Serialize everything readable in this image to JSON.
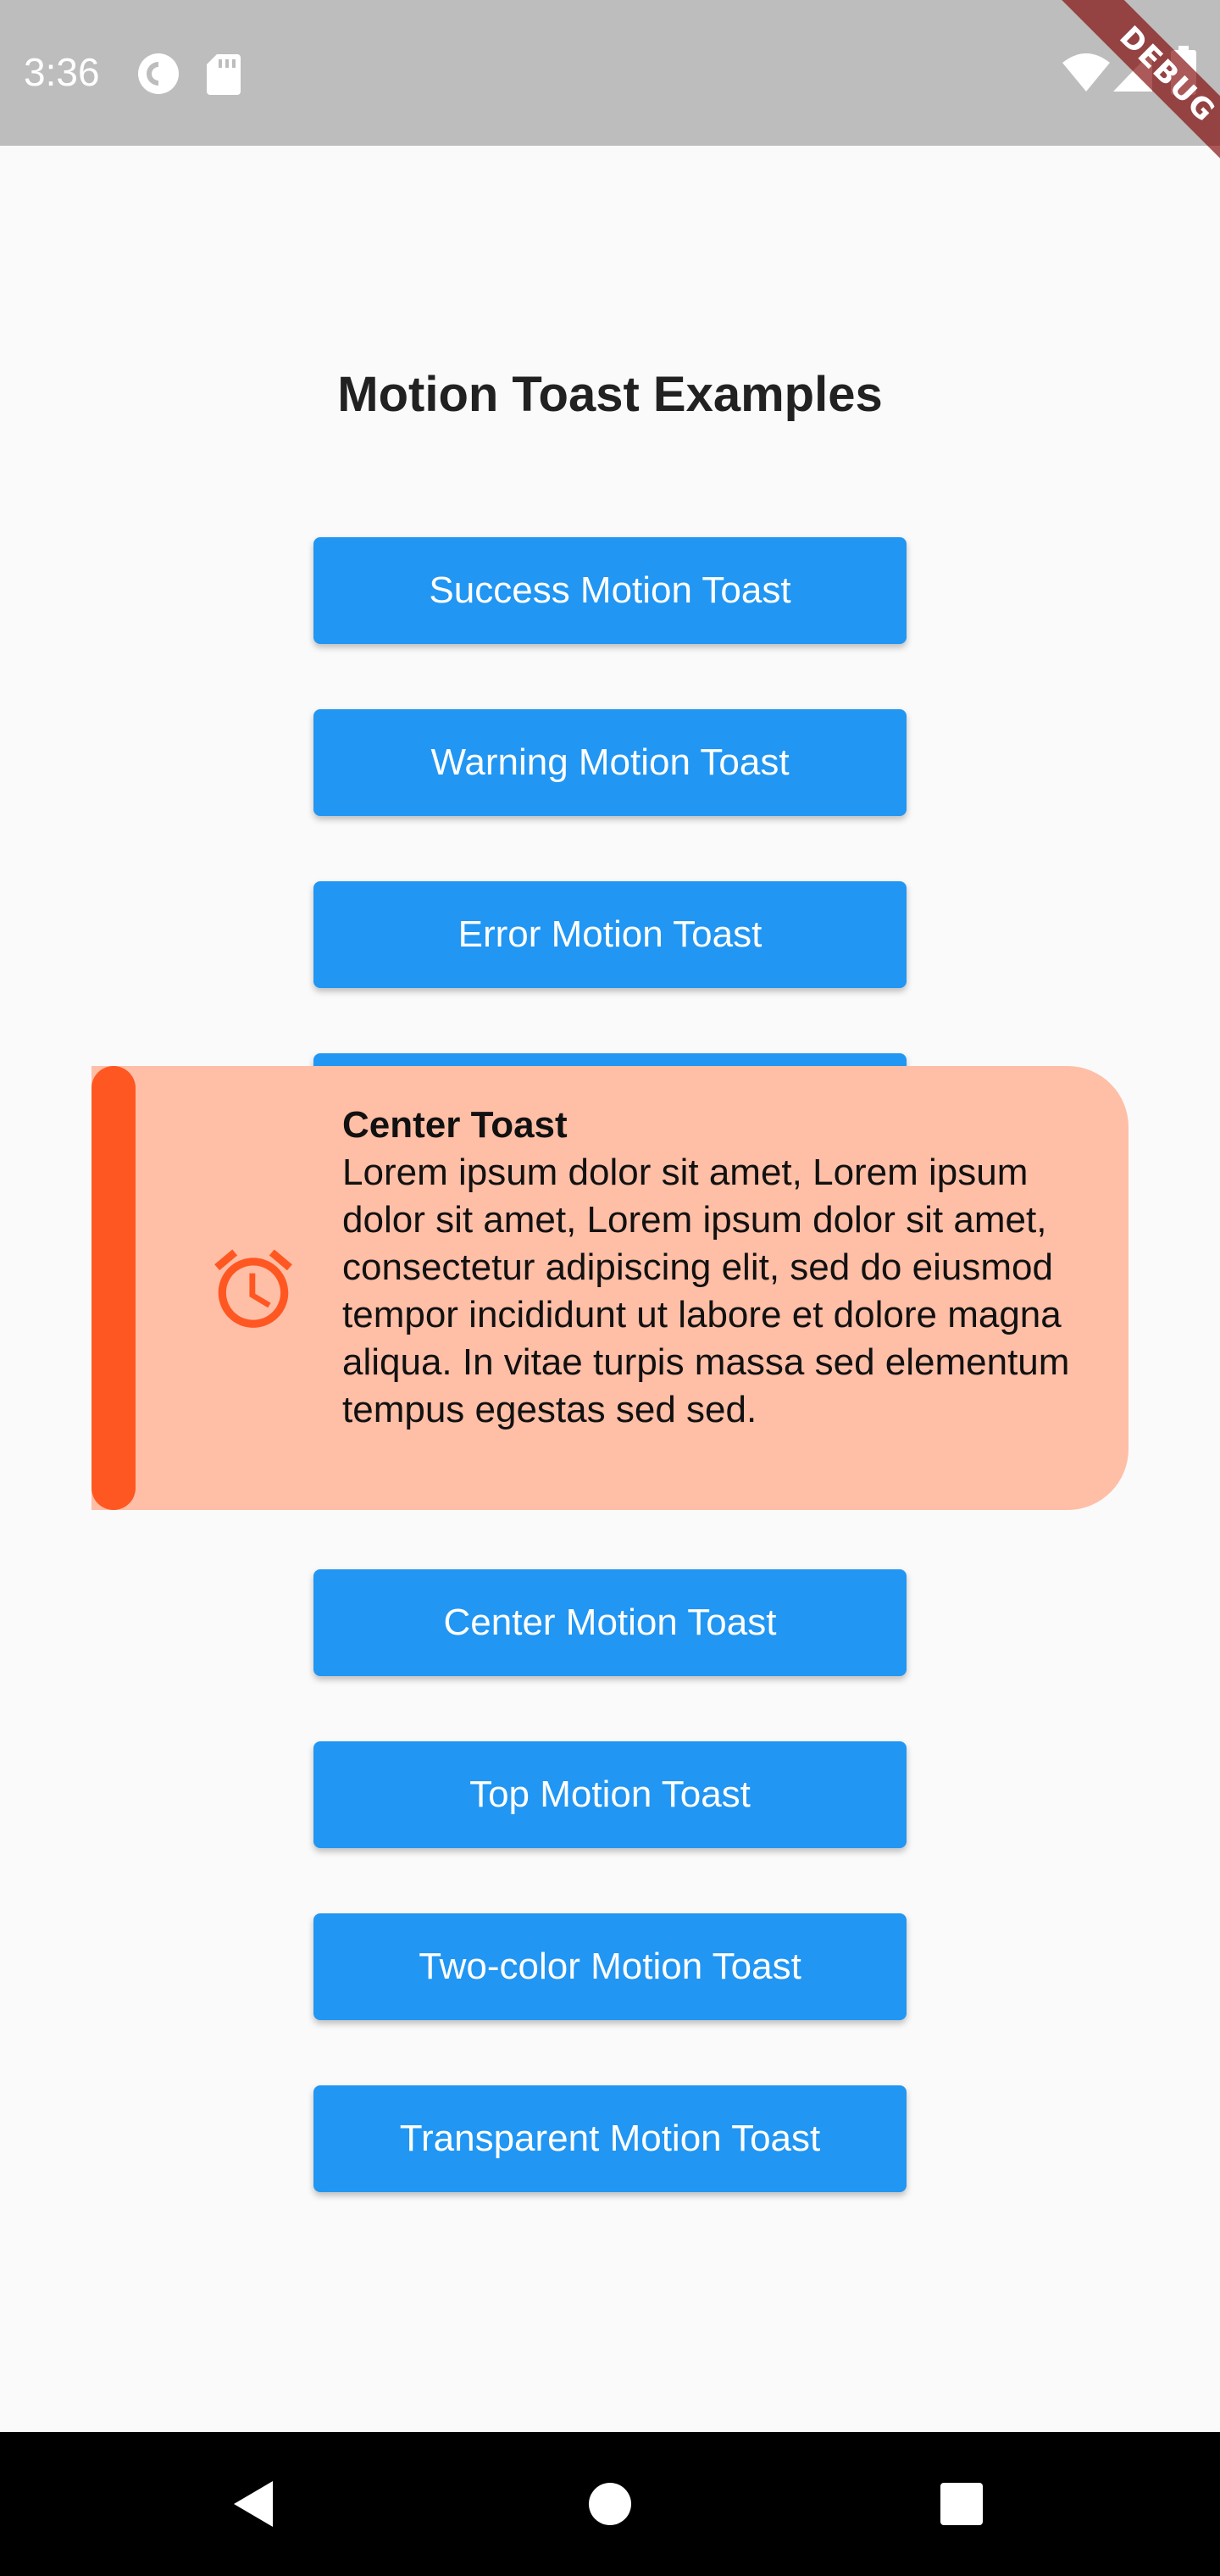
{
  "status_bar": {
    "time": "3:36",
    "debug_label": "DEBUG",
    "icons": [
      "pocket-casts-icon",
      "sd-card-icon",
      "wifi-icon",
      "cellular-signal-icon",
      "battery-icon"
    ]
  },
  "page": {
    "title": "Motion Toast Examples"
  },
  "buttons": [
    {
      "label": "Success Motion Toast"
    },
    {
      "label": "Warning Motion Toast"
    },
    {
      "label": "Error Motion Toast"
    },
    {
      "label": "Center Motion Toast"
    },
    {
      "label": "Top Motion Toast"
    },
    {
      "label": "Two-color Motion Toast"
    },
    {
      "label": "Transparent Motion Toast"
    }
  ],
  "toast": {
    "title": "Center Toast",
    "message": "Lorem ipsum dolor sit amet, Lorem ipsum dolor sit amet, Lorem ipsum dolor sit amet, consectetur adipiscing elit, sed do eiusmod tempor incididunt ut labore et dolore magna aliqua. In vitae turpis massa sed elementum tempus egestas sed sed.",
    "icon": "alarm-icon",
    "accent_color": "#ff5722",
    "background_color": "#ffbea6"
  },
  "nav_bar": {
    "icons": [
      "back-icon",
      "home-icon",
      "recents-icon"
    ]
  },
  "colors": {
    "button": "#2196f3",
    "status_bar": "#bdbdbd"
  }
}
